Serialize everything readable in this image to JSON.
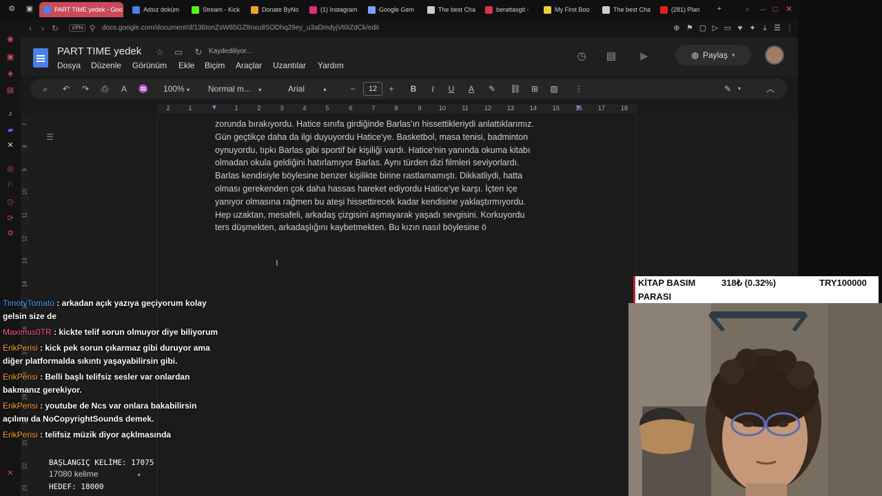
{
  "tabs": [
    {
      "title": "PART TIME yedek - Goo",
      "active": true
    },
    {
      "title": "Adsız doküm"
    },
    {
      "title": "Stream - Kick"
    },
    {
      "title": "Donate ByNo"
    },
    {
      "title": "(1) Instagram"
    },
    {
      "title": "Google Gem"
    },
    {
      "title": "The best Cha"
    },
    {
      "title": "berattasgit -"
    },
    {
      "title": "My First Boo"
    },
    {
      "title": "The best Cha"
    },
    {
      "title": "(281) Plan"
    }
  ],
  "address": {
    "vpn": "VPN",
    "url": "docs.google.com/document/d/136tonZsW85GZ8nxu8SODhq29ey_u3aDmdyjVt0iZdCk/edit"
  },
  "doc": {
    "title": "PART TIME  yedek",
    "status": "Kaydediliyor...",
    "menu": [
      "Dosya",
      "Düzenle",
      "Görünüm",
      "Ekle",
      "Biçim",
      "Araçlar",
      "Uzantılar",
      "Yardım"
    ],
    "share": "Paylaş"
  },
  "toolbar": {
    "zoom": "100%",
    "style": "Normal m...",
    "font": "Arial",
    "font_size": "12"
  },
  "ruler": [
    "2",
    "1",
    "1",
    "2",
    "3",
    "4",
    "5",
    "6",
    "7",
    "8",
    "9",
    "10",
    "11",
    "12",
    "13",
    "14",
    "15",
    "16",
    "17",
    "18"
  ],
  "vruler": [
    "7",
    "8",
    "9",
    "10",
    "11",
    "12",
    "13",
    "14",
    "15",
    "16",
    "17",
    "18",
    "19",
    "20",
    "21",
    "22",
    "23"
  ],
  "body_lines": [
    "zorunda bırakıyordu. Hatice sınıfa girdiğinde Barlas'ın hissettikleriydi anlattıklarımız.",
    "Gün geçtikçe daha da ilgi duyuyordu Hatice'ye. Basketbol, masa tenisi, badminton",
    "oynuyordu, tıpkı Barlas gibi sportif bir kişiliği vardı. Hatice'nin yanında okuma kitabı",
    "olmadan okula geldiğini hatırlamıyor Barlas. Aynı türden dizi filmleri seviyorlardı.",
    "Barlas kendisiyle böylesine benzer kişilikte birine rastlamamıştı. Dikkatliydi, hatta",
    "olması gerekenden çok daha hassas hareket ediyordu Hatice'ye karşı. İçten içe",
    "yanıyor olmasına rağmen bu ateşi hissettirecek kadar kendisine yaklaştırmıyordu.",
    "Hep uzaktan, mesafeli, arkadaş çizgisini aşmayarak yaşadı sevgisini. Korkuyordu",
    "ters düşmekten, arkadaşlığını kaybetmekten. Bu kızın nasıl böylesine ö"
  ],
  "chat": [
    {
      "user": "TimotyTomato",
      "color": "#4aa3ff",
      "text": " : arkadan açık yazıya geçiyorum kolay gelsin size de"
    },
    {
      "user": "Maximus0TR",
      "color": "#ff5a8a",
      "text": " : kickte telif sorun olmuyor diye biliyorum"
    },
    {
      "user": "ErikPerisi",
      "color": "#ffa533",
      "text": " : kick pek sorun çıkarmaz gibi duruyor ama diğer platformalda sıkıntı yaşayabilirsin gibi."
    },
    {
      "user": "ErikPerisi",
      "color": "#ffa533",
      "text": " : Belli başlı telifsiz sesler var onlardan bakmanız gerekiyor."
    },
    {
      "user": "ErikPerisi",
      "color": "#ffa533",
      "text": " : youtube de Ncs var onlara bakabilirsin açılımı da NoCopyrightSounds demek."
    },
    {
      "user": "ErikPerisi",
      "color": "#ffa533",
      "text": " : telifsiz müzik diyor açklmasında"
    }
  ],
  "counter": {
    "start_label": "BAŞLANGIÇ KELİME: 17075",
    "words": "17080 kelime",
    "target_label": "HEDEF: 18000"
  },
  "ticker": {
    "line1_label": "KİTAP BASIM",
    "line2_label": "PARASI",
    "amount": "318₺ (0.32%)",
    "goal": "TRY100000"
  }
}
